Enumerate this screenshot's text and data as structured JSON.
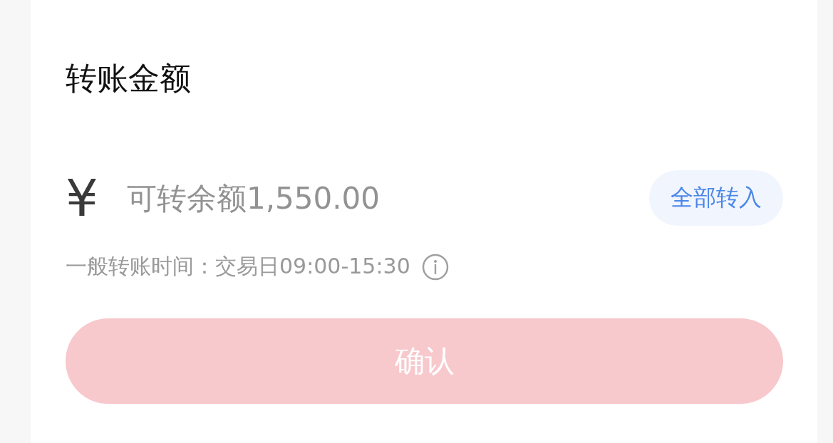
{
  "section_title": "转账金额",
  "amount": {
    "currency": "¥",
    "placeholder": "可转余额1,550.00",
    "all_button": "全部转入"
  },
  "notice": "一般转账时间：交易日09:00-15:30",
  "confirm": {
    "label": "确认",
    "disabled": true
  }
}
